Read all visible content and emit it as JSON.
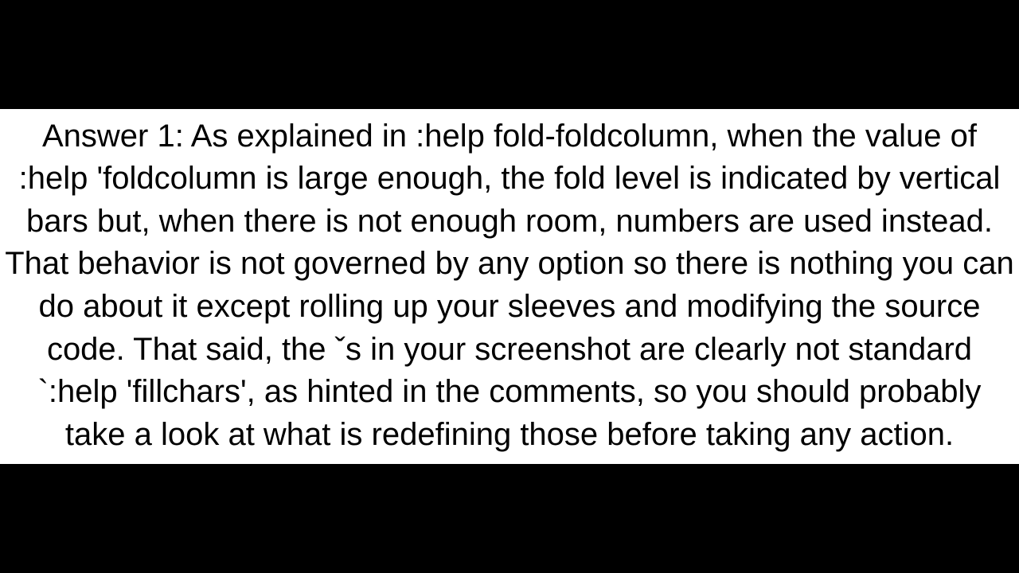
{
  "answer": {
    "body": "Answer 1: As explained in :help fold-foldcolumn, when the value of :help 'foldcolumn is large enough, the fold level is indicated by vertical bars but, when there is not enough room, numbers are used instead. That behavior is not governed by any option so there is nothing you can do about it except rolling up your sleeves and modifying the source code. That said, the ˇs in your screenshot are clearly not standard `:help 'fillchars', as hinted in the comments, so you should probably take a look at what is redefining those before taking any action."
  }
}
